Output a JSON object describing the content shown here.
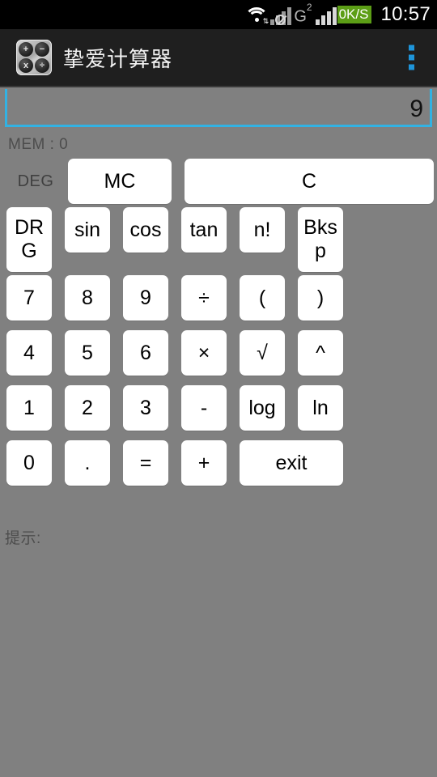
{
  "status_bar": {
    "wifi_icon": "wifi-icon",
    "signal_icon": "signal-bars-no-service-icon",
    "network_type": "G",
    "network_superscript": "2",
    "signal2_icon": "signal-bars-icon",
    "net_speed": "0K/S",
    "clock": "10:57"
  },
  "action_bar": {
    "app_icon": "calculator-app-icon",
    "icon_glyphs": [
      "+",
      "−",
      "x",
      "÷"
    ],
    "title": "挚爱计算器",
    "overflow_label": "overflow-menu-icon"
  },
  "display": {
    "value": "9",
    "memory": "MEM : 0"
  },
  "keypad": {
    "mode_label": "DEG",
    "row_top": [
      {
        "label": "MC",
        "name": "memory-clear-button"
      },
      {
        "label": "C",
        "name": "clear-button"
      }
    ],
    "row_fn": [
      {
        "label": "DRG",
        "name": "drg-button"
      },
      {
        "label": "sin",
        "name": "sin-button"
      },
      {
        "label": "cos",
        "name": "cos-button"
      },
      {
        "label": "tan",
        "name": "tan-button"
      },
      {
        "label": "n!",
        "name": "factorial-button"
      },
      {
        "label": "Bksp",
        "name": "backspace-button"
      }
    ],
    "row1": [
      {
        "label": "7",
        "name": "digit-7-button"
      },
      {
        "label": "8",
        "name": "digit-8-button"
      },
      {
        "label": "9",
        "name": "digit-9-button"
      },
      {
        "label": "÷",
        "name": "divide-button"
      },
      {
        "label": "(",
        "name": "open-paren-button"
      },
      {
        "label": ")",
        "name": "close-paren-button"
      }
    ],
    "row2": [
      {
        "label": "4",
        "name": "digit-4-button"
      },
      {
        "label": "5",
        "name": "digit-5-button"
      },
      {
        "label": "6",
        "name": "digit-6-button"
      },
      {
        "label": "×",
        "name": "multiply-button"
      },
      {
        "label": "√",
        "name": "sqrt-button"
      },
      {
        "label": "^",
        "name": "power-button"
      }
    ],
    "row3": [
      {
        "label": "1",
        "name": "digit-1-button"
      },
      {
        "label": "2",
        "name": "digit-2-button"
      },
      {
        "label": "3",
        "name": "digit-3-button"
      },
      {
        "label": "-",
        "name": "minus-button"
      },
      {
        "label": "log",
        "name": "log-button"
      },
      {
        "label": "ln",
        "name": "ln-button"
      }
    ],
    "row4": [
      {
        "label": "0",
        "name": "digit-0-button"
      },
      {
        "label": ".",
        "name": "decimal-point-button"
      },
      {
        "label": "=",
        "name": "equals-button"
      },
      {
        "label": "+",
        "name": "plus-button"
      },
      {
        "label": "exit",
        "name": "exit-button"
      }
    ]
  },
  "hint": "提示:",
  "colors": {
    "background": "#808080",
    "action_bar": "#1f1f1f",
    "accent_underline": "#32b2e3",
    "overflow_blue": "#1e95da",
    "net_speed_green": "#5c9e16",
    "button_face": "#ffffff"
  }
}
